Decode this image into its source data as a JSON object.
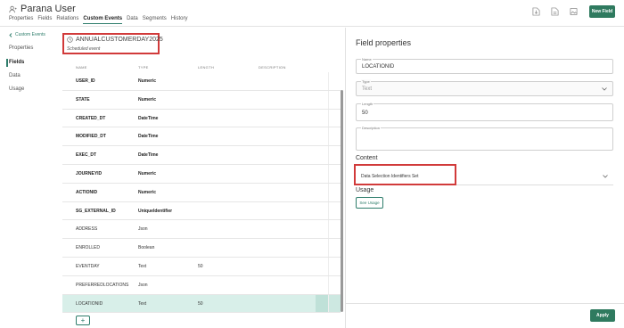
{
  "header": {
    "title": "Parana User",
    "tabs": [
      {
        "label": "Properties",
        "active": false
      },
      {
        "label": "Fields",
        "active": false
      },
      {
        "label": "Relations",
        "active": false
      },
      {
        "label": "Custom Events",
        "active": true
      },
      {
        "label": "Data",
        "active": false
      },
      {
        "label": "Segments",
        "active": false
      },
      {
        "label": "History",
        "active": false
      }
    ],
    "new_field_label": "New Field"
  },
  "leftnav": {
    "back_label": "Custom Events",
    "items": [
      {
        "label": "Properties",
        "active": false
      },
      {
        "label": "Fields",
        "active": true
      },
      {
        "label": "Data",
        "active": false
      },
      {
        "label": "Usage",
        "active": false
      }
    ]
  },
  "event": {
    "name": "ANNUALCUSTOMERDAY2025",
    "subtitle": "Scheduled event"
  },
  "table": {
    "columns": [
      "NAME",
      "TYPE",
      "LENGTH",
      "DESCRIPTION"
    ],
    "rows": [
      {
        "name": "USER_ID",
        "type": "Numeric",
        "length": "",
        "description": "",
        "system": true,
        "selected": false
      },
      {
        "name": "STATE",
        "type": "Numeric",
        "length": "",
        "description": "",
        "system": true,
        "selected": false
      },
      {
        "name": "CREATED_DT",
        "type": "DateTime",
        "length": "",
        "description": "",
        "system": true,
        "selected": false
      },
      {
        "name": "MODIFIED_DT",
        "type": "DateTime",
        "length": "",
        "description": "",
        "system": true,
        "selected": false
      },
      {
        "name": "EXEC_DT",
        "type": "DateTime",
        "length": "",
        "description": "",
        "system": true,
        "selected": false
      },
      {
        "name": "JOURNEYID",
        "type": "Numeric",
        "length": "",
        "description": "",
        "system": true,
        "selected": false
      },
      {
        "name": "ACTIONID",
        "type": "Numeric",
        "length": "",
        "description": "",
        "system": true,
        "selected": false
      },
      {
        "name": "SG_EXTERNAL_ID",
        "type": "UniqueIdentifier",
        "length": "",
        "description": "",
        "system": true,
        "selected": false
      },
      {
        "name": "ADDRESS",
        "type": "Json",
        "length": "",
        "description": "",
        "system": false,
        "selected": false
      },
      {
        "name": "ENROLLED",
        "type": "Boolean",
        "length": "",
        "description": "",
        "system": false,
        "selected": false
      },
      {
        "name": "EVENTDAY",
        "type": "Text",
        "length": "50",
        "description": "",
        "system": false,
        "selected": false
      },
      {
        "name": "PREFERREDLOCATIONS",
        "type": "Json",
        "length": "",
        "description": "",
        "system": false,
        "selected": false
      },
      {
        "name": "LOCATIONID",
        "type": "Text",
        "length": "50",
        "description": "",
        "system": false,
        "selected": true
      }
    ],
    "add_label": "+"
  },
  "panel": {
    "title": "Field properties",
    "name_label": "Name",
    "name_value": "LOCATIONID",
    "type_label": "Type",
    "type_value": "Text",
    "length_label": "Length",
    "length_value": "50",
    "description_label": "Description",
    "description_value": "",
    "content_heading": "Content",
    "content_value": "Data Selection Identifiers Set",
    "usage_heading": "Usage",
    "see_usage_label": "See Usage",
    "apply_label": "Apply"
  },
  "colors": {
    "accent": "#2e7d6b",
    "button": "#2f7a5f",
    "highlight_box": "#d13a3a",
    "selected_row": "#d8efe9"
  }
}
